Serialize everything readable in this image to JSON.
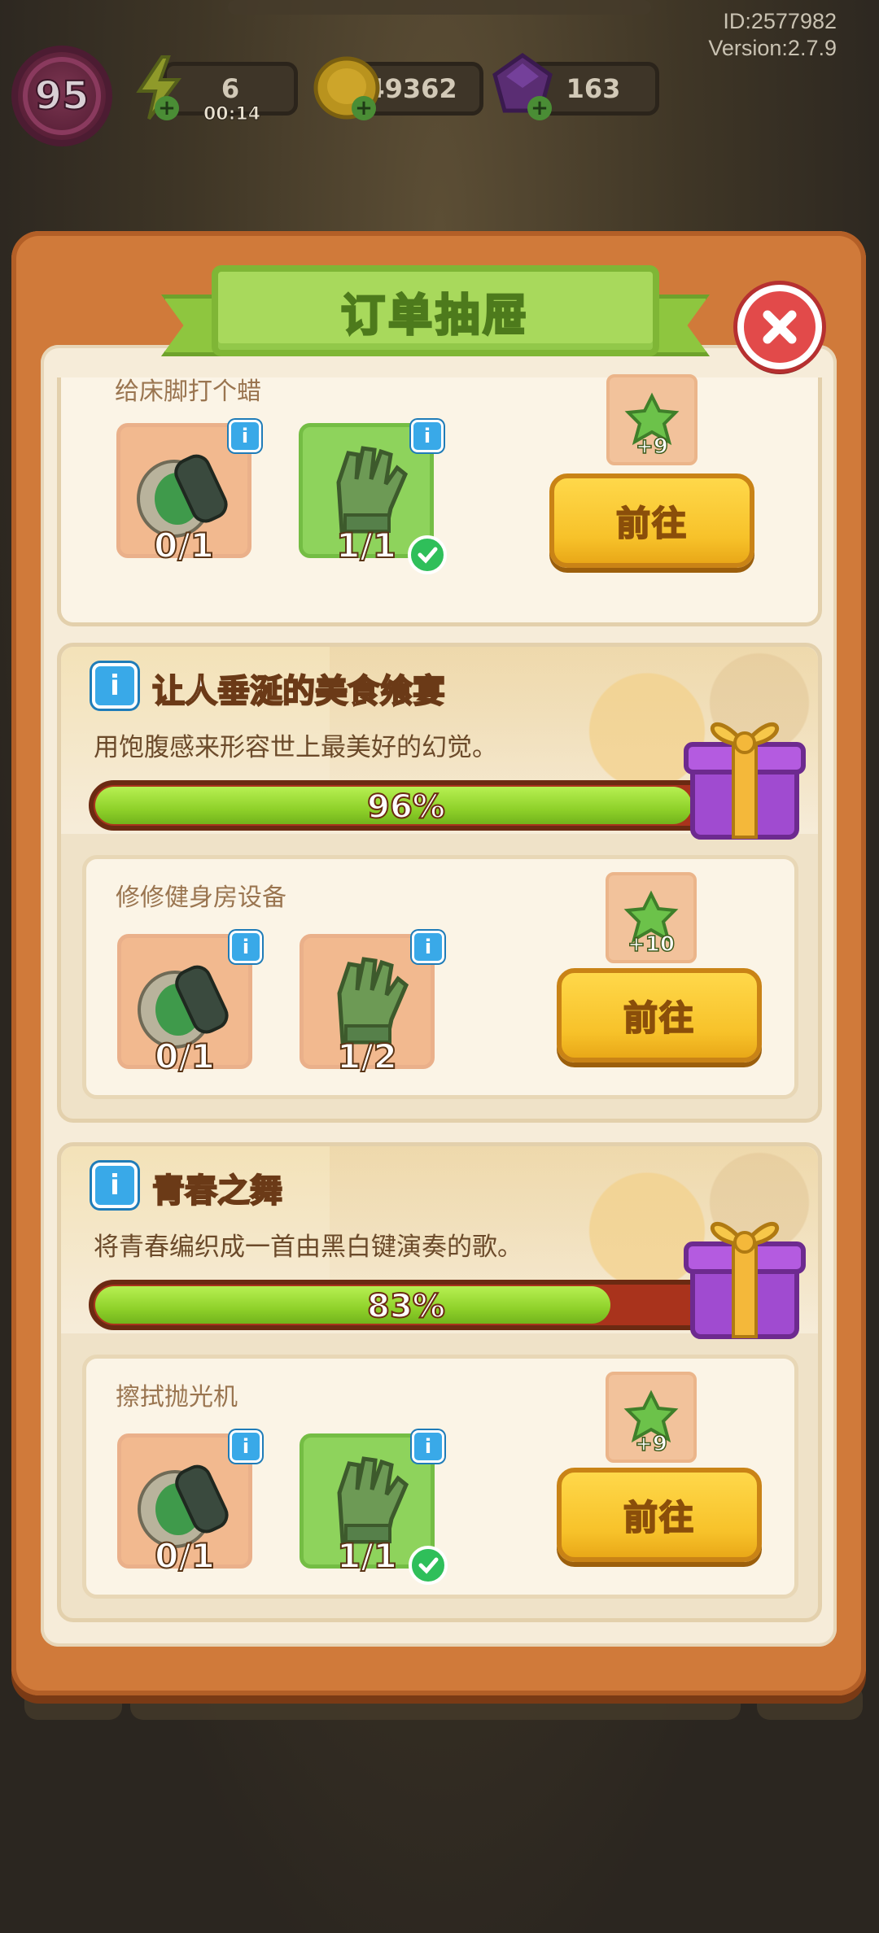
{
  "hud": {
    "id_text": "ID:2577982",
    "version_text": "Version:2.7.9",
    "level": "95",
    "energy": "6",
    "energy_timer": "00:14",
    "coins": "49362",
    "gems": "163"
  },
  "panel": {
    "title": "订单抽屉"
  },
  "top_partial_task": {
    "name": "给床脚打个蜡",
    "items": [
      {
        "icon": "polisher-icon",
        "count": "0/1",
        "done": false
      },
      {
        "icon": "glove-icon",
        "count": "1/1",
        "done": true
      }
    ],
    "reward": "+9",
    "button": "前往"
  },
  "orders": [
    {
      "title": "让人垂涎的美食飨宴",
      "description": "用饱腹感来形容世上最美好的幻觉。",
      "progress_label": "96%",
      "progress": 0.96,
      "task": {
        "name": "修修健身房设备",
        "items": [
          {
            "icon": "polisher-icon",
            "count": "0/1",
            "done": false
          },
          {
            "icon": "glove-icon",
            "count": "1/2",
            "done": false
          }
        ],
        "reward": "+10",
        "button": "前往"
      }
    },
    {
      "title": "青春之舞",
      "description": "将青春编织成一首由黑白键演奏的歌。",
      "progress_label": "83%",
      "progress": 0.83,
      "task": {
        "name": "擦拭抛光机",
        "items": [
          {
            "icon": "polisher-icon",
            "count": "0/1",
            "done": false
          },
          {
            "icon": "glove-icon",
            "count": "1/1",
            "done": true
          }
        ],
        "reward": "+9",
        "button": "前往"
      }
    }
  ],
  "colors": {
    "panel": "#d07a3a",
    "banner": "#a8d95c",
    "progress_fill": "#8fd12a",
    "progress_track": "#a9331c",
    "button": "#f7c22a",
    "close": "#e24a4a",
    "info": "#39a9e8"
  }
}
